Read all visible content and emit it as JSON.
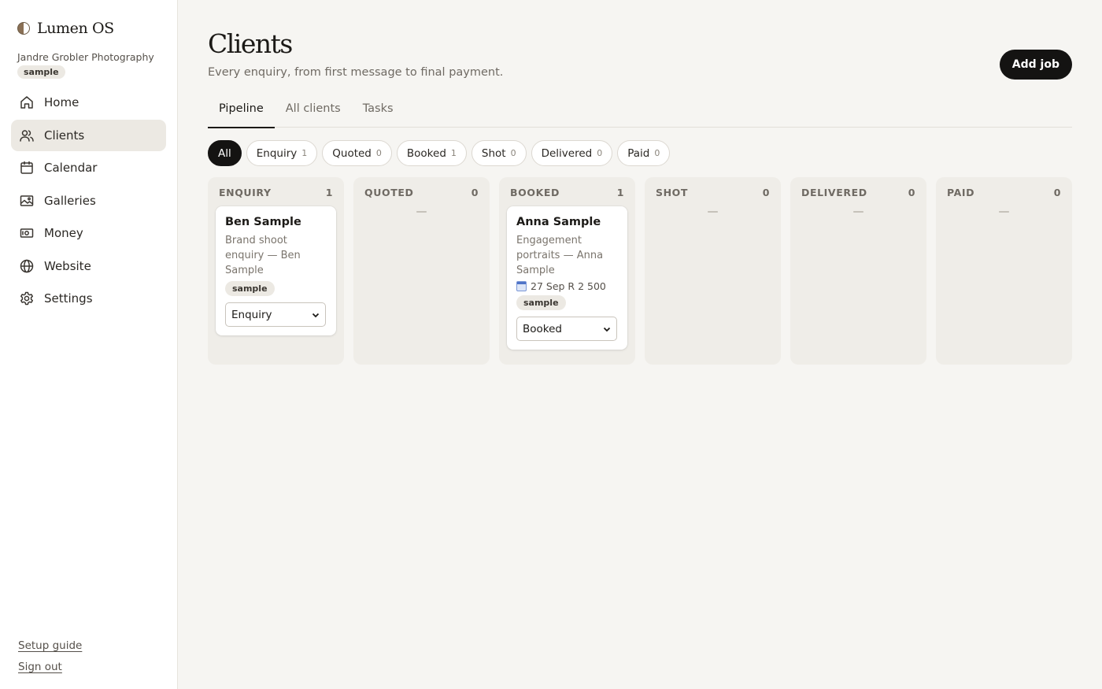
{
  "app": {
    "name": "Lumen OS",
    "workspace": "Jandre Grobler Photography",
    "workspace_badge": "sample"
  },
  "nav": [
    {
      "label": "Home",
      "icon": "home-icon"
    },
    {
      "label": "Clients",
      "icon": "users-icon",
      "active": true
    },
    {
      "label": "Calendar",
      "icon": "calendar-icon"
    },
    {
      "label": "Galleries",
      "icon": "image-icon"
    },
    {
      "label": "Money",
      "icon": "money-icon"
    },
    {
      "label": "Website",
      "icon": "globe-icon"
    },
    {
      "label": "Settings",
      "icon": "gear-icon"
    }
  ],
  "footer": {
    "setup_guide": "Setup guide",
    "sign_out": "Sign out"
  },
  "page": {
    "title": "Clients",
    "subtitle": "Every enquiry, from first message to final payment.",
    "add_job": "Add job"
  },
  "tabs": [
    {
      "label": "Pipeline",
      "active": true
    },
    {
      "label": "All clients"
    },
    {
      "label": "Tasks"
    }
  ],
  "filters": [
    {
      "label": "All",
      "count": "",
      "active": true
    },
    {
      "label": "Enquiry",
      "count": "1"
    },
    {
      "label": "Quoted",
      "count": "0"
    },
    {
      "label": "Booked",
      "count": "1"
    },
    {
      "label": "Shot",
      "count": "0"
    },
    {
      "label": "Delivered",
      "count": "0"
    },
    {
      "label": "Paid",
      "count": "0"
    }
  ],
  "columns": [
    {
      "title": "ENQUIRY",
      "count": "1",
      "empty": "—",
      "card": {
        "name": "Ben Sample",
        "desc": "Brand shoot enquiry — Ben Sample",
        "tag": "sample",
        "stage": "Enquiry"
      }
    },
    {
      "title": "QUOTED",
      "count": "0",
      "empty": "—"
    },
    {
      "title": "BOOKED",
      "count": "1",
      "empty": "—",
      "card": {
        "name": "Anna Sample",
        "desc": "Engagement portraits — Anna Sample",
        "meta": "27 Sep R 2 500",
        "tag": "sample",
        "stage": "Booked"
      }
    },
    {
      "title": "SHOT",
      "count": "0",
      "empty": "—"
    },
    {
      "title": "DELIVERED",
      "count": "0",
      "empty": "—"
    },
    {
      "title": "PAID",
      "count": "0",
      "empty": "—"
    }
  ]
}
